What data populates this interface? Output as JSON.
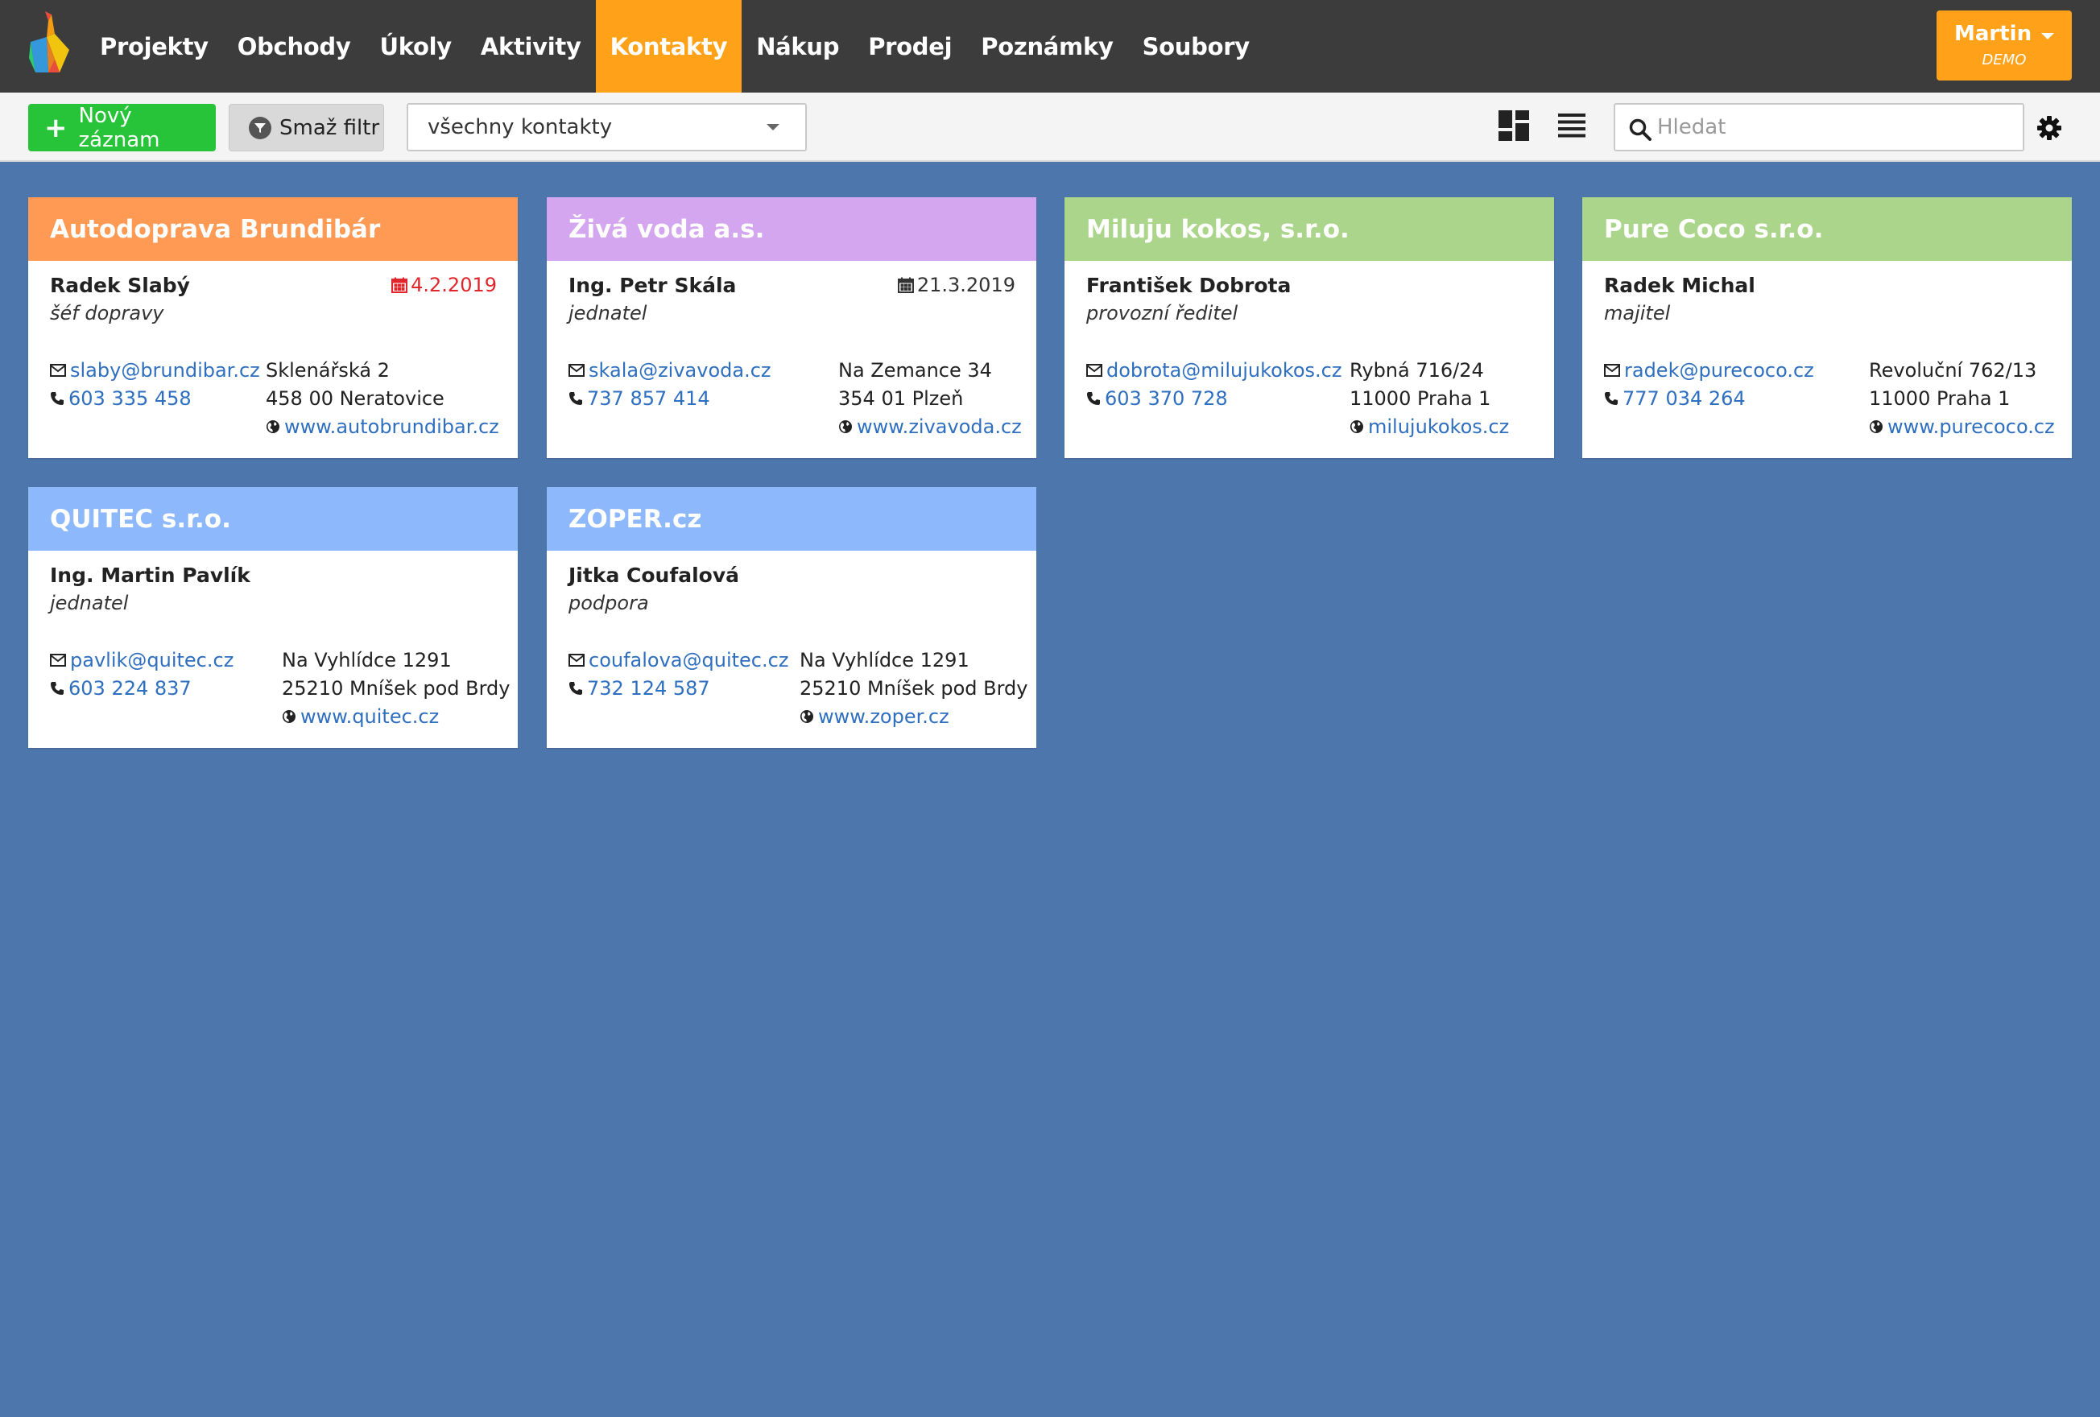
{
  "nav": {
    "items": [
      {
        "label": "Projekty"
      },
      {
        "label": "Obchody"
      },
      {
        "label": "Úkoly"
      },
      {
        "label": "Aktivity"
      },
      {
        "label": "Kontakty"
      },
      {
        "label": "Nákup"
      },
      {
        "label": "Prodej"
      },
      {
        "label": "Poznámky"
      },
      {
        "label": "Soubory"
      }
    ],
    "active": "Kontakty"
  },
  "user": {
    "name": "Martin",
    "subtitle": "DEMO"
  },
  "toolbar": {
    "new_label": "Nový záznam",
    "clear_filter_label": "Smaž filtr",
    "filter_selected": "všechny kontakty",
    "search_placeholder": "Hledat"
  },
  "icons": {
    "logo": "origami-giraffe-logo",
    "grid_view": "dashboard-grid-icon",
    "list_view": "list-icon",
    "search": "search-icon",
    "settings": "gear-icon",
    "email": "envelope-icon",
    "phone": "phone-icon",
    "web": "globe-icon",
    "date": "calendar-icon"
  },
  "colors": {
    "accent": "#ffa21a",
    "nav_bg": "#3c3c3c",
    "page_bg": "#4d77ac",
    "new_button": "#27c43a",
    "link": "#2f6fbf",
    "overdue": "#e0252b"
  },
  "cards": [
    {
      "company": "Autodoprava Brundibár",
      "header_color": "#ff9a55",
      "person": "Radek Slabý",
      "role": "šéf dopravy",
      "date": "4.2.2019",
      "date_overdue": true,
      "email": "slaby@brundibar.cz",
      "phone": "603 335 458",
      "address_line1": "Sklenářská 2",
      "address_line2": "458 00 Neratovice",
      "web": "www.autobrundibar.cz"
    },
    {
      "company": "Živá voda a.s.",
      "header_color": "#d4a6f0",
      "person": "Ing. Petr Skála",
      "role": "jednatel",
      "date": "21.3.2019",
      "date_overdue": false,
      "email": "skala@zivavoda.cz",
      "phone": "737 857 414",
      "address_line1": "Na Zemance 34",
      "address_line2": "354 01 Plzeň",
      "web": "www.zivavoda.cz"
    },
    {
      "company": "Miluju kokos, s.r.o.",
      "header_color": "#acd58c",
      "person": "František Dobrota",
      "role": "provozní ředitel",
      "date": "",
      "date_overdue": false,
      "email": "dobrota@milujukokos.cz",
      "phone": "603 370 728",
      "address_line1": "Rybná 716/24",
      "address_line2": "11000 Praha 1",
      "web": "milujukokos.cz"
    },
    {
      "company": "Pure Coco s.r.o.",
      "header_color": "#acd58c",
      "person": "Radek Michal",
      "role": "majitel",
      "date": "",
      "date_overdue": false,
      "email": "radek@purecoco.cz",
      "phone": "777 034 264",
      "address_line1": "Revoluční 762/13",
      "address_line2": "11000 Praha 1",
      "web": "www.purecoco.cz"
    },
    {
      "company": "QUITEC s.r.o.",
      "header_color": "#8db8fb",
      "person": "Ing. Martin Pavlík",
      "role": "jednatel",
      "date": "",
      "date_overdue": false,
      "email": "pavlik@quitec.cz",
      "phone": "603 224 837",
      "address_line1": "Na Vyhlídce 1291",
      "address_line2": "25210 Mníšek pod Brdy",
      "web": "www.quitec.cz"
    },
    {
      "company": "ZOPER.cz",
      "header_color": "#8db8fb",
      "person": "Jitka Coufalová",
      "role": "podpora",
      "date": "",
      "date_overdue": false,
      "email": "coufalova@quitec.cz",
      "phone": "732 124 587",
      "address_line1": "Na Vyhlídce 1291",
      "address_line2": "25210 Mníšek pod Brdy",
      "web": "www.zoper.cz"
    }
  ]
}
